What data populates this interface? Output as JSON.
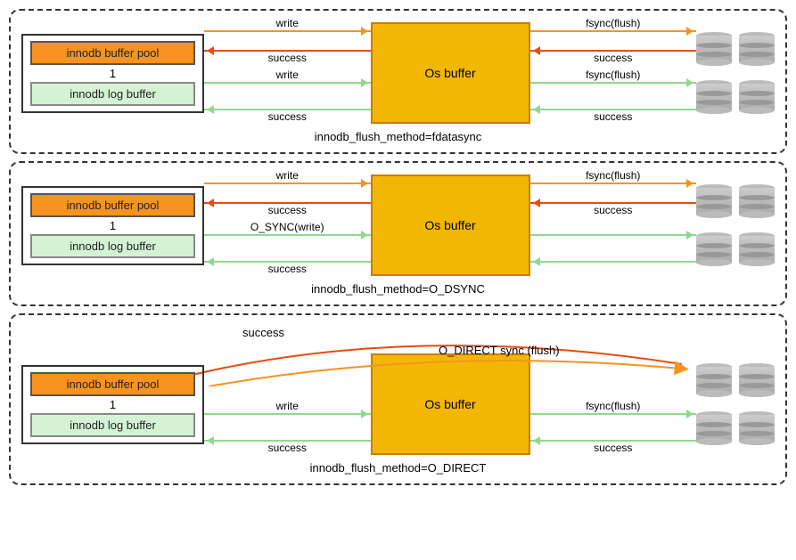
{
  "panels": [
    {
      "pool_label": "innodb buffer pool",
      "log_label": "innodb log buffer",
      "number": "1",
      "os_label": "Os buffer",
      "caption": "innodb_flush_method=fdatasync",
      "left": {
        "l1": "write",
        "l2": "success",
        "l3": "write",
        "l4": "success"
      },
      "right": {
        "r1": "fsync(flush)",
        "r2": "success",
        "r3": "fsync(flush)",
        "r4": "success"
      }
    },
    {
      "pool_label": "innodb buffer pool",
      "log_label": "innodb log buffer",
      "number": "1",
      "os_label": "Os buffer",
      "caption": "innodb_flush_method=O_DSYNC",
      "left": {
        "l1": "write",
        "l2": "success",
        "l3": "O_SYNC(write)",
        "l4": "success"
      },
      "right": {
        "r1": "fsync(flush)",
        "r2": "success",
        "r3": "",
        "r4": ""
      }
    },
    {
      "pool_label": "innodb buffer pool",
      "log_label": "innodb log buffer",
      "number": "1",
      "os_label": "Os buffer",
      "caption": "innodb_flush_method=O_DIRECT",
      "curve_top": "success",
      "curve_bot": "O_DIRECT  sync (flush)",
      "left": {
        "l3": "write",
        "l4": "success"
      },
      "right": {
        "r3": "fsync(flush)",
        "r4": "success"
      }
    }
  ]
}
